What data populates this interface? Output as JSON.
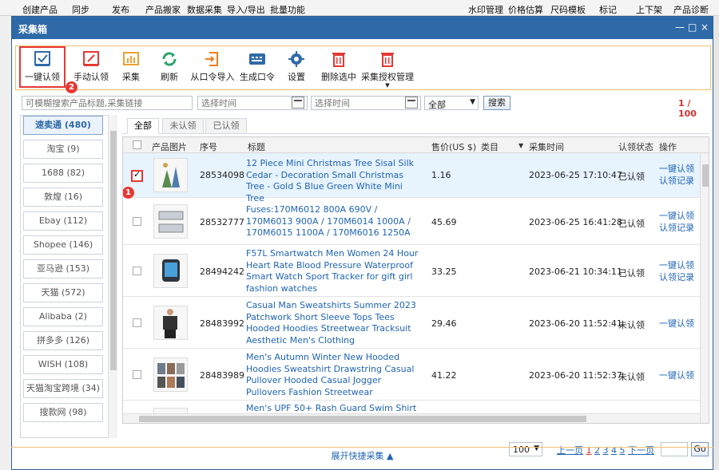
{
  "app_menu": [
    "创建产品",
    "同步",
    "发布",
    "产品搬家",
    "数据采集",
    "导入/导出",
    "批量功能",
    "水印管理",
    "价格估算",
    "尺码模板",
    "标记",
    "上下架",
    "产品诊断"
  ],
  "window": {
    "title": "采集箱",
    "controls": [
      "—",
      "□",
      "×"
    ]
  },
  "toolbar": [
    {
      "label": "一键认领",
      "icon": "claim-box-icon",
      "color": "#2f6aa8"
    },
    {
      "label": "手动认领",
      "icon": "manual-claim-icon",
      "color": "#e53935"
    },
    {
      "label": "采集",
      "icon": "collect-chart-icon",
      "color": "#f0a030"
    },
    {
      "label": "刷新",
      "icon": "refresh-icon",
      "color": "#2aa66a"
    },
    {
      "label": "从口令导入",
      "icon": "import-icon",
      "color": "#f07d20"
    },
    {
      "label": "生成口令",
      "icon": "generate-code-icon",
      "color": "#2f6aa8"
    },
    {
      "label": "设置",
      "icon": "gear-icon",
      "color": "#2f6aa8"
    },
    {
      "label": "删除选中",
      "icon": "trash-icon",
      "color": "#e53935"
    },
    {
      "label": "采集授权管理",
      "icon": "auth-trash-icon",
      "color": "#e53935"
    }
  ],
  "annotations": [
    "1",
    "2"
  ],
  "filters": {
    "search_placeholder": "可模糊搜索产品标题,采集链接",
    "date_from_placeholder": "选择时间",
    "date_to_placeholder": "选择时间",
    "status_select": "全部",
    "search_button": "搜索",
    "count": "1 / 100"
  },
  "sidebar": [
    {
      "label": "速卖通 (480)",
      "active": true
    },
    {
      "label": "淘宝 (9)"
    },
    {
      "label": "1688 (82)"
    },
    {
      "label": "敦煌 (16)"
    },
    {
      "label": "Ebay (112)"
    },
    {
      "label": "Shopee (146)"
    },
    {
      "label": "亚马逊 (153)"
    },
    {
      "label": "天猫 (572)"
    },
    {
      "label": "Alibaba (2)"
    },
    {
      "label": "拼多多 (126)"
    },
    {
      "label": "WISH (108)"
    },
    {
      "label": "天猫淘宝跨境 (34)"
    },
    {
      "label": "搜款网 (98)"
    }
  ],
  "tabs": [
    "全部",
    "未认领",
    "已认领"
  ],
  "columns": [
    "产品图片",
    "序号",
    "标题",
    "售价(US $)",
    "类目",
    "采集时间",
    "认领状态",
    "操作"
  ],
  "rows": [
    {
      "id": "28534098",
      "title": "12 Piece Mini Christmas Tree Sisal Silk Cedar - Decoration Small Christmas Tree - Gold S Blue Green White Mini Tree",
      "price": "1.16",
      "time": "2023-06-25 17:10:47",
      "status": "已认领",
      "ops": [
        "一键认领",
        "认领记录"
      ],
      "checked": true,
      "thumb_color": "#6f8e5c"
    },
    {
      "id": "28532777",
      "title": "Fuses:170M6012 800A 690V / 170M6013 900A / 170M6014 1000A / 170M6015 1100A / 170M6016 1250A",
      "price": "45.69",
      "time": "2023-06-25 16:41:28",
      "status": "已认领",
      "ops": [
        "一键认领",
        "认领记录"
      ],
      "checked": false,
      "thumb_color": "#bfc6ce"
    },
    {
      "id": "28494242",
      "title": "F57L Smartwatch Men Women 24 Hour Heart Rate Blood Pressure Waterproof Smart Watch Sport Tracker for gift girl fashion watches",
      "price": "33.25",
      "time": "2023-06-21 10:34:11",
      "status": "已认领",
      "ops": [
        "一键认领",
        "认领记录"
      ],
      "checked": false,
      "thumb_color": "#303a46"
    },
    {
      "id": "28483992",
      "title": "Casual Man Sweatshirts Summer 2023 Patchwork Short Sleeve Tops Tees Hooded Hoodies Streetwear Tracksuit Aesthetic Men's Clothing",
      "price": "29.46",
      "time": "2023-06-20 11:52:41",
      "status": "未认领",
      "ops": [
        "一键认领"
      ],
      "checked": false,
      "thumb_color": "#3a3a3a"
    },
    {
      "id": "28483989",
      "title": "Men's Autumn Winter New Hooded Hoodies Sweatshirt Drawstring Casual Pullover Hooded Casual Jogger Pullovers Fashion Streetwear",
      "price": "41.22",
      "time": "2023-06-20 11:52:37",
      "status": "未认领",
      "ops": [
        "一键认领"
      ],
      "checked": false,
      "thumb_color": "#8a6a58"
    },
    {
      "id": "",
      "title": "Men's UPF 50+ Rash Guard Swim Shirt",
      "price": "",
      "time": "",
      "status": "",
      "ops": [],
      "checked": false,
      "thumb_color": "#4d79b0"
    }
  ],
  "pager": {
    "page_size": "100",
    "prev": "上一页",
    "pages": [
      "1",
      "2",
      "3",
      "4",
      "5"
    ],
    "next": "下一页",
    "go": "Go"
  },
  "expand_label": "展开快捷采集 ▲"
}
